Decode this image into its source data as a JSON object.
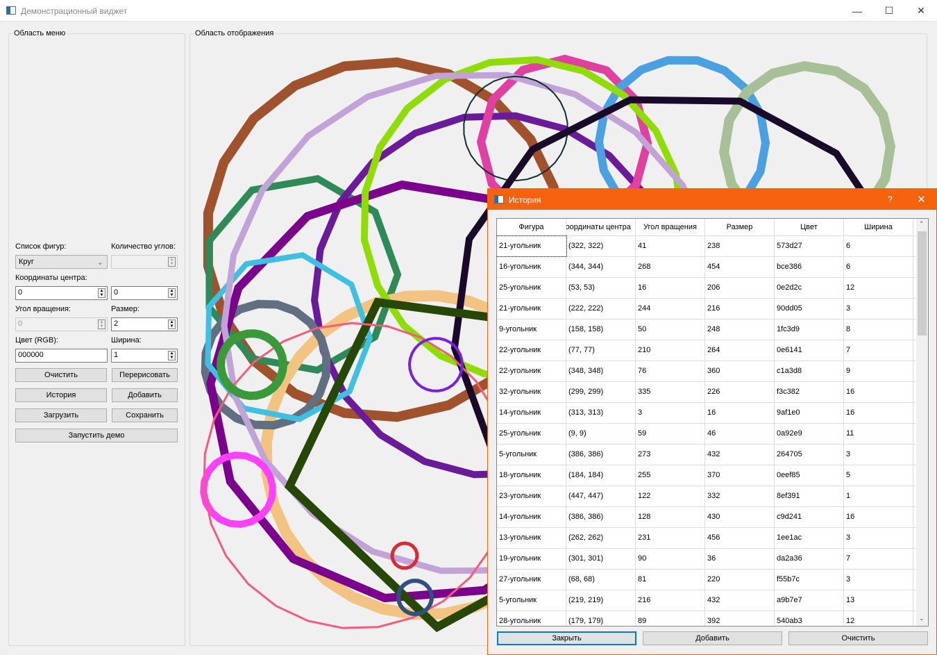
{
  "window": {
    "title": "Демонстрационный виджет"
  },
  "menu_group": {
    "title": "Область меню",
    "shapes_label": "Список фигур:",
    "shape_value": "Круг",
    "corners_label": "Количество углов:",
    "corners_value": "",
    "center_label": "Координаты центра:",
    "center_x": "0",
    "center_y": "0",
    "angle_label": "Угол вращения:",
    "angle_value": "0",
    "size_label": "Размер:",
    "size_value": "2",
    "color_label": "Цвет (RGB):",
    "color_value": "000000",
    "width_label": "Ширина:",
    "width_value": "1",
    "buttons": {
      "clear": "Очистить",
      "redraw": "Перерисовать",
      "history": "История",
      "add": "Добавить",
      "load": "Загрузить",
      "save": "Сохранить",
      "demo": "Запустить демо"
    }
  },
  "display_group": {
    "title": "Область отображения"
  },
  "history_dialog": {
    "title": "История",
    "help": "?",
    "accent": "#f7630c",
    "columns": [
      "Фигура",
      "Координаты центра",
      "Угол вращения",
      "Размер",
      "Цвет",
      "Ширина"
    ],
    "rows": [
      [
        "21-угольник",
        "(322, 322)",
        "41",
        "238",
        "573d27",
        "6"
      ],
      [
        "16-угольник",
        "(344, 344)",
        "268",
        "454",
        "bce386",
        "6"
      ],
      [
        "25-угольник",
        "(53, 53)",
        "16",
        "206",
        "0e2d2c",
        "12"
      ],
      [
        "21-угольник",
        "(222, 222)",
        "244",
        "216",
        "90dd05",
        "3"
      ],
      [
        "9-угольник",
        "(158, 158)",
        "50",
        "248",
        "1fc3d9",
        "8"
      ],
      [
        "22-угольник",
        "(77, 77)",
        "210",
        "264",
        "0e6141",
        "7"
      ],
      [
        "22-угольник",
        "(348, 348)",
        "76",
        "360",
        "c1a3d8",
        "9"
      ],
      [
        "32-угольник",
        "(299, 299)",
        "335",
        "226",
        "f3c382",
        "16"
      ],
      [
        "14-угольник",
        "(313, 313)",
        "3",
        "16",
        "9af1e0",
        "16"
      ],
      [
        "25-угольник",
        "(9, 9)",
        "59",
        "46",
        "0a92e9",
        "11"
      ],
      [
        "5-угольник",
        "(386, 386)",
        "273",
        "432",
        "264705",
        "3"
      ],
      [
        "18-угольник",
        "(184, 184)",
        "255",
        "370",
        "0eef85",
        "5"
      ],
      [
        "23-угольник",
        "(447, 447)",
        "122",
        "332",
        "8ef391",
        "1"
      ],
      [
        "14-угольник",
        "(386, 386)",
        "128",
        "430",
        "c9d241",
        "16"
      ],
      [
        "13-угольник",
        "(262, 262)",
        "231",
        "456",
        "1ee1ac",
        "3"
      ],
      [
        "19-угольник",
        "(301, 301)",
        "90",
        "36",
        "da2a36",
        "7"
      ],
      [
        "27-угольник",
        "(68, 68)",
        "81",
        "220",
        "f55b7c",
        "3"
      ],
      [
        "5-угольник",
        "(219, 219)",
        "216",
        "432",
        "a9b7e7",
        "13"
      ],
      [
        "28-угольник",
        "(179, 179)",
        "89",
        "392",
        "540ab3",
        "12"
      ]
    ],
    "buttons": {
      "close": "Закрыть",
      "add": "Добавить",
      "clear": "Очистить"
    }
  }
}
